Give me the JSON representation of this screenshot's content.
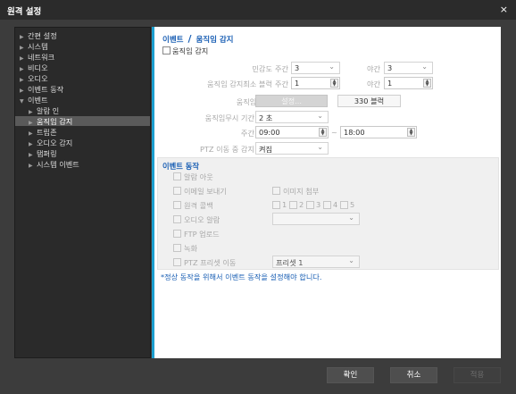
{
  "window": {
    "title": "원격 설정",
    "close_icon": "×"
  },
  "sidebar": {
    "items": [
      {
        "label": "간편 설정"
      },
      {
        "label": "시스템"
      },
      {
        "label": "네트워크"
      },
      {
        "label": "비디오"
      },
      {
        "label": "오디오"
      },
      {
        "label": "이벤트 동작"
      },
      {
        "label": "이벤트"
      },
      {
        "label": "알람 인"
      },
      {
        "label": "움직임 감지"
      },
      {
        "label": "트립존"
      },
      {
        "label": "오디오 감지"
      },
      {
        "label": "탬퍼링"
      },
      {
        "label": "시스템 이벤트"
      }
    ]
  },
  "content": {
    "breadcrumb": {
      "parent": "이벤트",
      "separator": "/",
      "current": "움직임 감지"
    },
    "enable_label": "움직임 감지",
    "sensitivity": {
      "label": "민감도",
      "day_label": "주간",
      "day_value": "3",
      "night_label": "야간",
      "night_value": "3"
    },
    "min_blocks": {
      "label": "움직임 감지최소 블럭",
      "day_label": "주간",
      "day_value": "1",
      "night_label": "야간",
      "night_value": "1"
    },
    "zone": {
      "label": "움직임 영역",
      "setup_button": "설정...",
      "blocks": "330 블럭"
    },
    "ignore": {
      "label": "움직임무시 기간",
      "value": "2 초"
    },
    "day_time": {
      "label": "주간",
      "start": "09:00",
      "sep": "~",
      "end": "18:00"
    },
    "ptz": {
      "label": "PTZ 이동 중 감지",
      "value": "켜짐"
    },
    "event_actions": {
      "title": "이벤트 동작",
      "alarm_out": "알람 아웃",
      "email": "이메일 보내기",
      "attach_image": "이미지 첨부",
      "remote_callback": "원격 콜백",
      "callbacks": [
        "1",
        "2",
        "3",
        "4",
        "5"
      ],
      "audio_alarm": "오디오 알람",
      "ftp_upload": "FTP 업로드",
      "record": "녹화",
      "ptz_preset": "PTZ 프리셋 이동",
      "preset_value": "프리셋 1"
    },
    "notice": "*정상 동작을 위해서 이벤트 동작을 설정해야 합니다."
  },
  "footer": {
    "ok": "확인",
    "cancel": "취소",
    "apply": "적용"
  }
}
